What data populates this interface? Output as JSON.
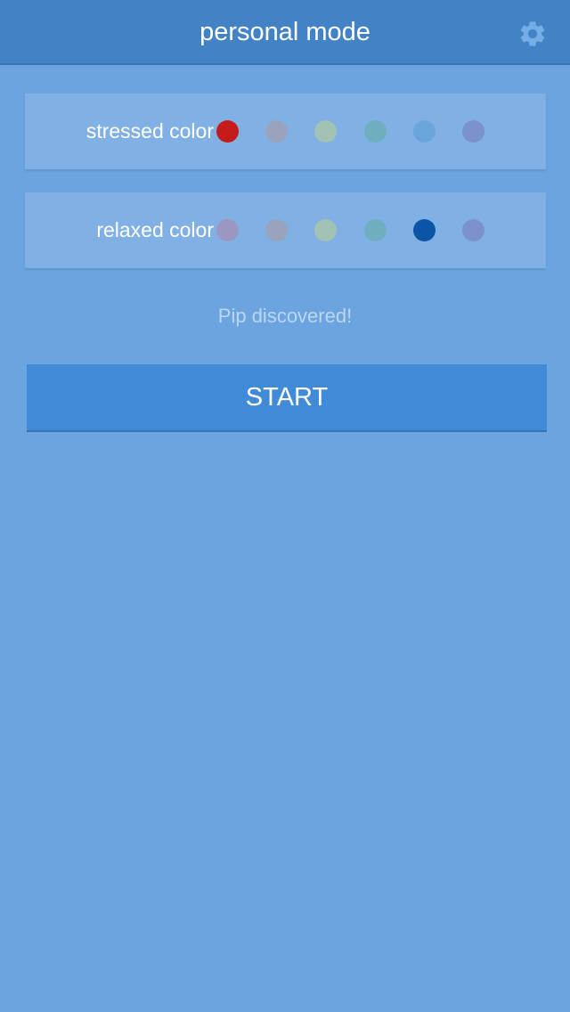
{
  "header": {
    "title": "personal mode",
    "settings_icon": "gear-icon"
  },
  "stressed": {
    "label": "stressed color",
    "selected_index": 0,
    "colors": [
      "#c61b1b",
      "#9aa3bd",
      "#a2c2b3",
      "#6eaebf",
      "#6aa6dc",
      "#7b92cc"
    ]
  },
  "relaxed": {
    "label": "relaxed color",
    "selected_index": 4,
    "colors": [
      "#9c97c0",
      "#9aa3bd",
      "#a2c2b3",
      "#6eaebf",
      "#0a55a6",
      "#7b92cc"
    ]
  },
  "status": {
    "text": "Pip discovered!"
  },
  "start": {
    "label": "START"
  },
  "theme": {
    "background": "#6ba4de",
    "topbar": "#4383c5",
    "panel": "#81b1e4",
    "button": "#418ad7"
  }
}
